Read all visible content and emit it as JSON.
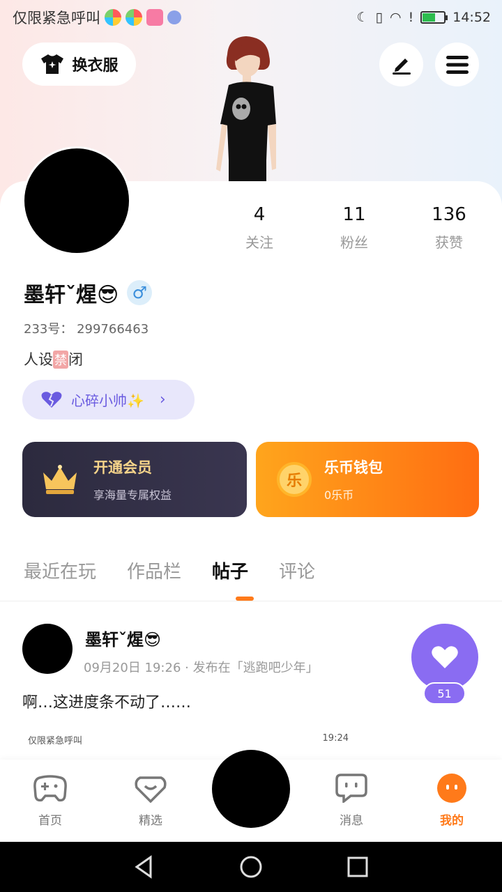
{
  "status_bar": {
    "carrier": "仅限紧急呼叫",
    "time": "14:52"
  },
  "header": {
    "outfit_label": "换衣服"
  },
  "profile": {
    "stats": [
      {
        "value": "4",
        "label": "关注"
      },
      {
        "value": "11",
        "label": "粉丝"
      },
      {
        "value": "136",
        "label": "获赞"
      }
    ],
    "nickname": "墨轩ˇ煋😎",
    "gender": "♂",
    "uid": "233号： 299766463",
    "bio_prefix": "人设",
    "bio_ban": "禁",
    "bio_suffix": "闭",
    "title_chip": "心碎小帅✨"
  },
  "cards": {
    "vip": {
      "title": "开通会员",
      "subtitle": "享海量专属权益"
    },
    "wallet": {
      "title": "乐币钱包",
      "subtitle": "0乐币",
      "coin": "乐"
    }
  },
  "tabs": [
    "最近在玩",
    "作品栏",
    "帖子",
    "评论"
  ],
  "post": {
    "author": "墨轩ˇ煋😎",
    "meta": "09月20日 19:26 · 发布在「逃跑吧少年」",
    "text": "啊…这进度条不动了……",
    "likes": "51",
    "preview_carrier": "仅限紧急呼叫",
    "preview_time": "19:24"
  },
  "bottom_nav": [
    {
      "label": "首页"
    },
    {
      "label": "精选"
    },
    {
      "label": "消息"
    },
    {
      "label": "我的"
    }
  ],
  "colors": {
    "accent": "#ff7a1a",
    "like": "#8a6cf2",
    "chip_text": "#6a5be0"
  }
}
